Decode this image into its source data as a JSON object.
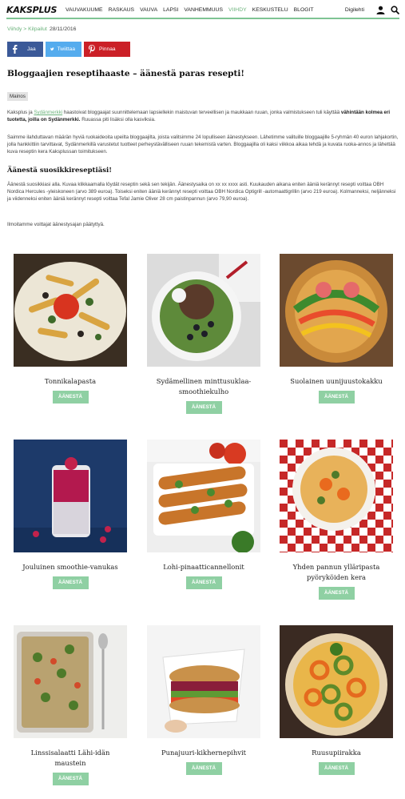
{
  "header": {
    "logo": "KAKSPLUS",
    "nav": [
      "VAUVAKUUME",
      "RASKAUS",
      "VAUVA",
      "LAPSI",
      "VANHEMMUUS",
      "VIIHDY",
      "KESKUSTELU",
      "BLOGIT"
    ],
    "active_nav": "VIIHDY",
    "digilehti": "Digilehti",
    "accent_color": "#7ec493"
  },
  "breadcrumb": {
    "path": "Viihdy > Kilpailut",
    "date": "28/11/2016"
  },
  "share": {
    "facebook": "Jaa",
    "twitter": "Twiittaa",
    "pinterest": "Pinnaa"
  },
  "article": {
    "title": "Bloggaajien reseptihaaste – äänestä paras resepti!",
    "tag": "Mainos",
    "p1_start": "Kaksplus ja ",
    "p1_link": "Sydänmerkki",
    "p1_mid": " haastoivat bloggaajat suunnittelemaan lapsiellekin maistuvan terveellisen ja maukkaan ruuan, jonka valmistukseen tuli käyttää ",
    "p1_bold": "vähintään kolmea eri tuotetta, joilla on Sydänmerkki.",
    "p1_end": " Ruuassa piti lisäksi olla kasviksia.",
    "p2": "Saimme ilahduttavan määrän hyviä ruokaideoita upeilta bloggaajilta, joista valitsimme 24 lopulliseen äänestykseen. Lähetimme valituille bloggaajille 5-ryhmän 40 euron lahjakortin, jolla hankkittiin tarvittavat, Sydänmerkillä varustetut tuotteet perheystävälliseen ruuan tekemistä varten. Bloggaajilla oli kaksi viikkoa aikaa tehdä ja kuvata ruoka-annos ja lähettää kuva reseptin kera Kaksplussan toimitukseen.",
    "h2": "Äänestä suosikkireseptiäsi!",
    "p3": "Äänestä suosikkiasi alla. Kuvaa klikkaamalla löydät reseptin sekä sen tekijän. Äänestysaika on xx xx xxxx asti. Kuukauden aikana eniten ääniä kerännyt resepti voittaa OBH Nordica Hercules -yleiskoneen (arvo 389 euroa). Toiseksi eniten ääniä kerännyt resepti voittaa OBH Nordica Optigrill -automaattigrillin (arvo 219 euroa). Kolmanneksi, neljänneksi ja viidenneksi eniten ääniä kerännyt resepti voittaa Tefal Jamie Oliver 28 cm paistinpannun (arvo 79,90 euroa).",
    "p4": "Ilmoitamme voittajat äänestysajan päätyttyä."
  },
  "vote_label": "ÄÄNESTÄ",
  "recipes": [
    {
      "title": "Tonnikalapasta"
    },
    {
      "title": "Sydämellinen minttusuklaa-smoothiekulho"
    },
    {
      "title": "Suolainen uunijuustokakku"
    },
    {
      "title": "Jouluinen smoothie-vanukas"
    },
    {
      "title": "Lohi-pinaatticannellonit"
    },
    {
      "title": "Yhden pannun ylläripasta pyöryköiden kera"
    },
    {
      "title": "Linssisalaatti Lähi-idän maustein"
    },
    {
      "title": "Punajuuri-kikhernepihvit"
    },
    {
      "title": "Ruusupiirakka"
    }
  ]
}
